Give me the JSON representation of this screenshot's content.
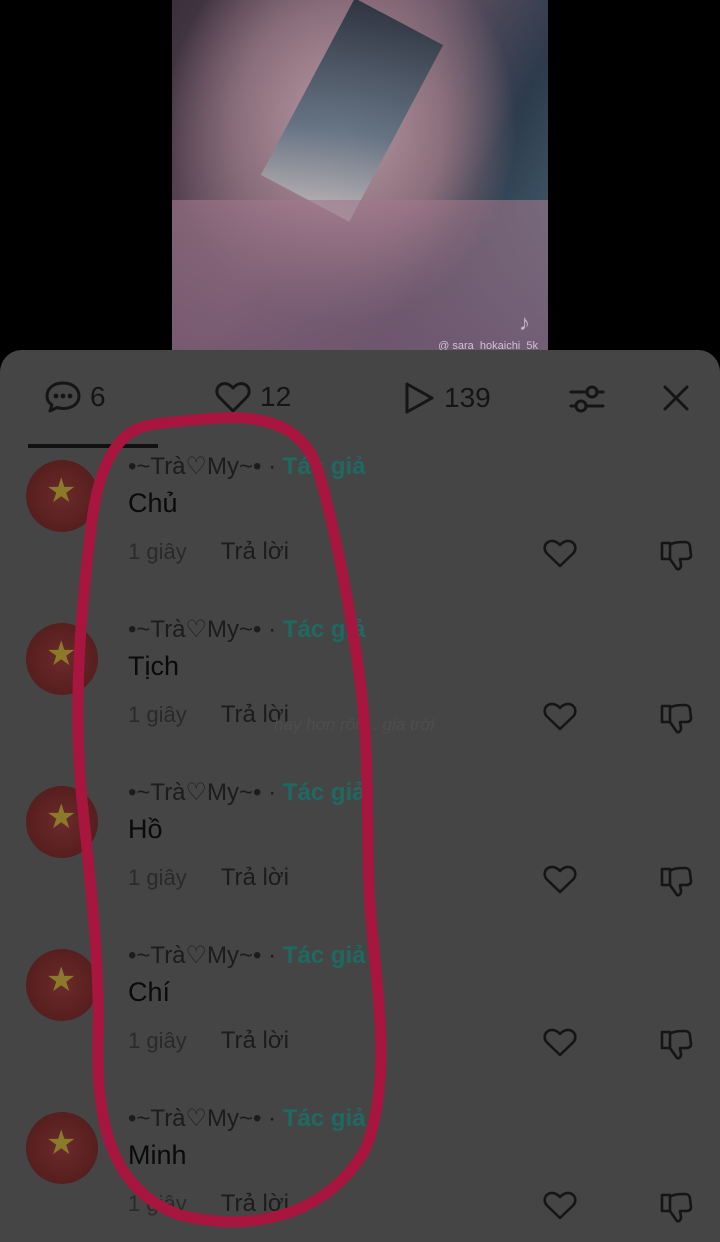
{
  "video": {
    "watermark": "@ sara_hokaichi_5k"
  },
  "tabs": {
    "comments_count": "6",
    "likes_count": "12",
    "views_count": "139"
  },
  "comments": [
    {
      "username": "•~Trà♡My~• · ",
      "badge": "Tác giả",
      "text": "Chủ",
      "time": "1 giây",
      "reply": "Trả lời"
    },
    {
      "username": "•~Trà♡My~• · ",
      "badge": "Tác giả",
      "text": "Tịch",
      "time": "1 giây",
      "reply": "Trả lời"
    },
    {
      "username": "•~Trà♡My~• · ",
      "badge": "Tác giả",
      "text": "Hồ",
      "time": "1 giây",
      "reply": "Trả lời"
    },
    {
      "username": "•~Trà♡My~• · ",
      "badge": "Tác giả",
      "text": "Chí",
      "time": "1 giây",
      "reply": "Trả lời"
    },
    {
      "username": "•~Trà♡My~• · ",
      "badge": "Tác giả",
      "text": "Minh",
      "time": "1 giây",
      "reply": "Trả lời"
    }
  ],
  "overlay_text": "hay hơn rồi ... gia trời",
  "colors": {
    "sheet_bg": "#454545",
    "author_badge": "#1e6a63",
    "annotation_stroke": "#a8163f"
  },
  "icons": {
    "comments": "comment-bubble-icon",
    "likes": "heart-icon",
    "views": "play-icon",
    "filter": "sliders-icon",
    "close": "close-icon",
    "like": "heart-outline-icon",
    "dislike": "thumbs-down-icon"
  }
}
